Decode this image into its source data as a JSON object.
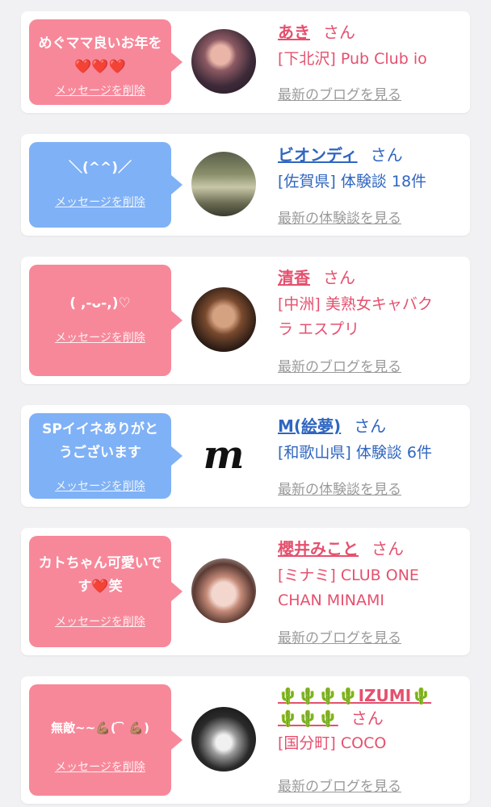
{
  "cards": [
    {
      "message": "めぐママ良いお年を❤️❤️❤️",
      "delete_label": "メッセージを削除",
      "name": "あき",
      "honorific": "さん",
      "shop_line1": "[下北沢] Pub Club io",
      "shop_line2": "",
      "link": "最新のブログを見る",
      "bubble_color": "#f7889a"
    },
    {
      "message": "＼(^^)／",
      "delete_label": "メッセージを削除",
      "name": "ビオンディ",
      "honorific": "さん",
      "shop_line1": "[佐賀県] 体験談 18件",
      "shop_line2": "",
      "link": "最新の体験談を見る",
      "bubble_color": "#7fb1f6"
    },
    {
      "message": "( ,-ᴗ-,)♡",
      "delete_label": "メッセージを削除",
      "name": "清香",
      "honorific": "さん",
      "shop_line1": "[中洲] 美熟女キャバク",
      "shop_line2": "ラ エスプリ",
      "link": "最新のブログを見る",
      "bubble_color": "#f7889a"
    },
    {
      "message": "SPイイネありがとうございます",
      "delete_label": "メッセージを削除",
      "name": "M(絵夢)",
      "honorific": "さん",
      "shop_line1": "[和歌山県] 体験談 6件",
      "shop_line2": "",
      "link": "最新の体験談を見る",
      "bubble_color": "#7fb1f6",
      "avatar_text": "m"
    },
    {
      "message": "カトちゃん可愛いです❤️笑",
      "delete_label": "メッセージを削除",
      "name": "櫻井みこと",
      "honorific": "さん",
      "shop_line1": "[ミナミ] CLUB ONE",
      "shop_line2": "CHAN MINAMI",
      "link": "最新のブログを見る",
      "bubble_color": "#f7889a"
    },
    {
      "message": "無敵~~💪🏽( ᷇ ᷆ 💪🏽)",
      "delete_label": "メッセージを削除",
      "name_line1": "🌵🌵🌵🌵IZUMI🌵",
      "name_line2": "🌵🌵🌵",
      "honorific": "さん",
      "shop_line1": "[国分町] COCO",
      "shop_line2": "",
      "link": "最新のブログを見る",
      "bubble_color": "#f7889a"
    }
  ]
}
